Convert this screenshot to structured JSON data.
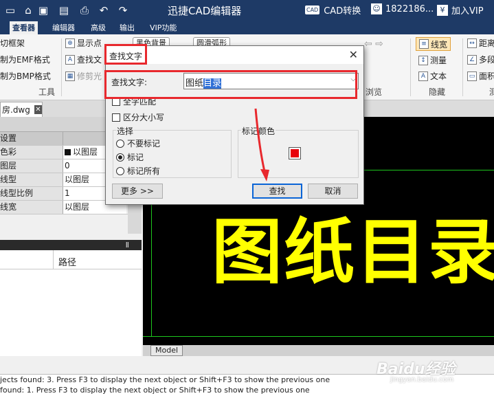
{
  "window": {
    "title": "迅捷CAD编辑器",
    "cad_convert": "CAD转换",
    "cad_badge": "CAD",
    "user": "1822186...",
    "vip": "加入VIP"
  },
  "quick_access": [
    "folder-open-icon",
    "save-icon",
    "save-pdf-icon",
    "print-icon",
    "undo-icon",
    "redo-icon"
  ],
  "menu_tabs": [
    "查看器",
    "编辑器",
    "高级",
    "输出",
    "VIP功能"
  ],
  "ribbon": {
    "tools": [
      "切框架",
      "制为EMF格式",
      "制为BMP格式"
    ],
    "tools_group": "工具",
    "display": [
      "显示点",
      "查找文",
      "修剪光"
    ],
    "bg_button": "黑色背景",
    "smooth_button": "圆滑弧形",
    "browse_group": "浏览",
    "hide_items": [
      "线宽",
      "测量",
      "文本"
    ],
    "hide_group": "隐藏",
    "right_items": [
      "距离",
      "多段",
      "面积"
    ],
    "right_group": "测"
  },
  "document_tab": "房.dwg",
  "properties": {
    "rows": [
      {
        "key": "设置",
        "value": ""
      },
      {
        "key": "色彩",
        "value": "以图层"
      },
      {
        "key": "图层",
        "value": "0"
      },
      {
        "key": "线型",
        "value": "以图层"
      },
      {
        "key": "线型比例",
        "value": "1"
      },
      {
        "key": "线宽",
        "value": "以图层"
      }
    ]
  },
  "pane2": {
    "pin": "Ⅱ",
    "path_label": "路径"
  },
  "canvas": {
    "text": "图纸目录",
    "model_tab": "Model"
  },
  "status": [
    "jects found: 3. Press F3 to display the next object or Shift+F3 to show the previous one",
    "found: 1. Press F3 to display the next object or Shift+F3 to show the previous one"
  ],
  "dialog": {
    "title": "查找文字",
    "close": "✕",
    "find_label": "查找文字:",
    "find_value_plain": "图纸",
    "find_value_selected": "目录",
    "whole_word": "全字匹配",
    "match_case": "区分大小写",
    "select_legend": "选择",
    "options": [
      "不要标记",
      "标记",
      "标记所有"
    ],
    "selected_option": 1,
    "mark_color_legend": "标记颜色",
    "mark_color": "#e8000b",
    "more_button": "更多 >>",
    "find_button": "查找",
    "cancel_button": "取消"
  },
  "watermark": {
    "main": "Baidu经验",
    "sub": "jingyan.baidu.com"
  }
}
